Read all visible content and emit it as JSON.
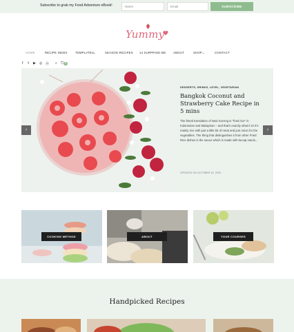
{
  "topbar": {
    "promo": "Subscribe to grab my Food Adventure eBook!",
    "name_placeholder": "Name",
    "email_placeholder": "Email",
    "subscribe_label": "SUBSCRIBE"
  },
  "logo": {
    "text": "Yummy"
  },
  "nav": {
    "items": [
      "HOME",
      "RECIPE INDEX",
      "TEMPLATES",
      "SEASON RECIPES",
      "14 SURPRISE ME",
      "ABOUT",
      "SHOP",
      "CONTACT"
    ]
  },
  "socials": [
    "facebook-icon",
    "twitter-icon",
    "youtube-icon",
    "instagram-icon",
    "pinterest-icon",
    "search-icon",
    "cart-icon"
  ],
  "cart_count": "0",
  "hero": {
    "categories": "DESSERTS, DRINKS, LEVEL, VEGETARIAN",
    "title": "Bangkok Coconut and Strawberry Cake Recipe in 5 mins",
    "excerpt": "The literal translation of Nasi Goreng is \"fried rice\" in Indonesian and Malaysian – and that's exactly what it is! It's mainly rice with just a little bit of meat and just onion for the vegetables. The thing that distinguishes it from other Fried Rice dishes is the sauce which is made with kecap manis...",
    "updated": "UPDATED ON OCTOBER 16, 2020"
  },
  "arrows": {
    "prev": "‹",
    "next": "›"
  },
  "cards": [
    {
      "label": "COOKING METHOD"
    },
    {
      "label": "ABOUT"
    },
    {
      "label": "YOUR COURSES"
    }
  ],
  "handpicked": {
    "heading": "Handpicked Recipes"
  }
}
